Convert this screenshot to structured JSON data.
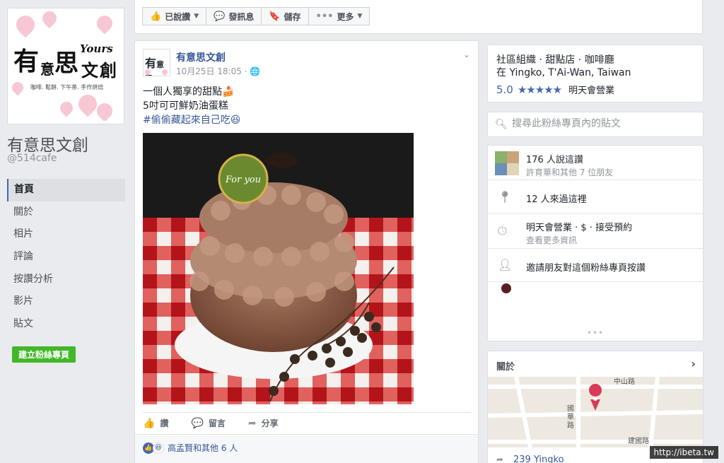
{
  "sidebar": {
    "page_name": "有意思文創",
    "page_handle": "@514cafe",
    "logo": {
      "big_chars": [
        "有",
        "意",
        "思",
        "文",
        "創"
      ],
      "english": "Yours",
      "tagline": "咖啡. 鬆餅. 下午茶. 手作烘焙"
    },
    "nav": [
      {
        "label": "首頁",
        "active": true
      },
      {
        "label": "關於"
      },
      {
        "label": "相片"
      },
      {
        "label": "評論"
      },
      {
        "label": "按讚分析"
      },
      {
        "label": "影片"
      },
      {
        "label": "貼文"
      }
    ],
    "create_page": "建立粉絲專頁"
  },
  "actionbar": {
    "liked": "已說讚",
    "message": "發訊息",
    "save": "儲存",
    "more": "更多"
  },
  "post": {
    "author": "有意思文創",
    "date": "10月25日 18:05",
    "text_line1": "一個人獨享的甜點🍰",
    "text_line2": "5吋可可鮮奶油蛋糕",
    "text_line3": "#偷偷藏起來自己吃😆",
    "image_label": "For you",
    "like": "讚",
    "comment": "留言",
    "share": "分享",
    "reactions": "高孟賢和其他 6 人"
  },
  "info": {
    "category": "社區組織 · 甜點店 · 咖啡廳",
    "location": "在 Yingko, T'Ai-Wan, Taiwan",
    "rating": "5.0",
    "stars": "★★★★★",
    "open_status": "明天會營業"
  },
  "search": {
    "placeholder": "搜尋此粉絲專頁內的貼文"
  },
  "stats": {
    "likes": "176 人說這讚",
    "likes_friends": "許育華和其他 7 位朋友",
    "visits": "12 人來過這裡",
    "hours": "明天會營業 · $ · 接受預約",
    "hours_more": "查看更多資訊",
    "invite": "邀請朋友對這個粉絲專頁按讚"
  },
  "about": {
    "title": "關於",
    "address": "239 Yingko",
    "map_labels": {
      "road1": "中山路",
      "road2": "國華路",
      "road3": "建國路"
    }
  },
  "watermark": "http://ibeta.tw"
}
